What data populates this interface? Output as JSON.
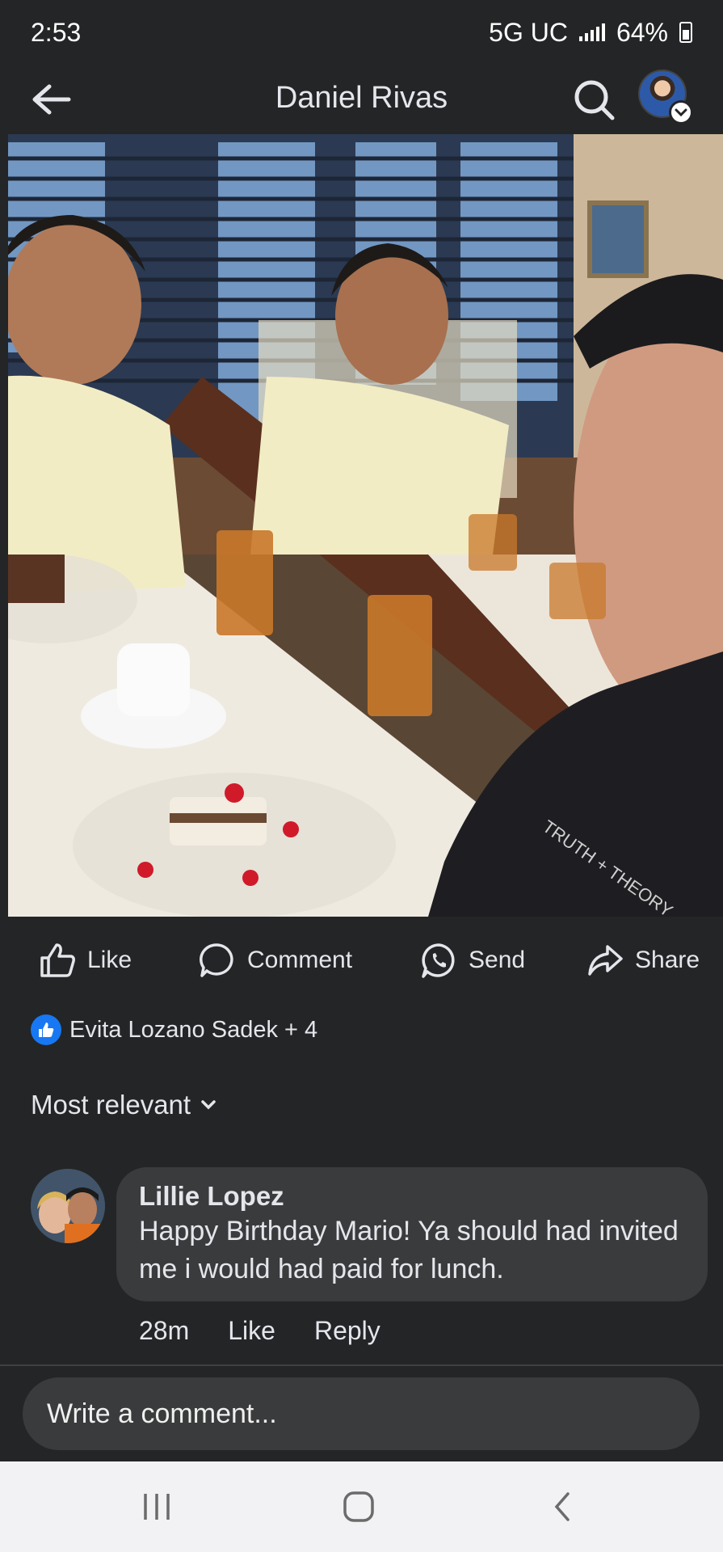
{
  "status_bar": {
    "time": "2:53",
    "network": "5G UC",
    "battery": "64%"
  },
  "header": {
    "title": "Daniel Rivas",
    "icons": {
      "back": "arrow-left-icon",
      "search": "search-icon",
      "profile_menu": "chevron-down-icon"
    }
  },
  "post": {
    "photo_alt": "Selfie of three men at a restaurant table with iced tea and desserts",
    "photo_shirt_text": "TRUTH + THEORY"
  },
  "actions": {
    "like": "Like",
    "comment": "Comment",
    "send": "Send",
    "share": "Share"
  },
  "reactions": {
    "icon": "thumbs-up-icon",
    "summary": "Evita Lozano Sadek + 4"
  },
  "comments_sort": {
    "label": "Most relevant"
  },
  "comments": [
    {
      "author": "Lillie Lopez",
      "text": "Happy Birthday Mario! Ya should had invited me i would had paid for lunch.",
      "time": "28m",
      "like_label": "Like",
      "reply_label": "Reply"
    }
  ],
  "composer": {
    "placeholder": "Write a comment..."
  },
  "colors": {
    "background": "#242526",
    "bubble": "#3a3b3c",
    "like_blue": "#1877f2",
    "nav_bar": "#f2f2f4"
  }
}
